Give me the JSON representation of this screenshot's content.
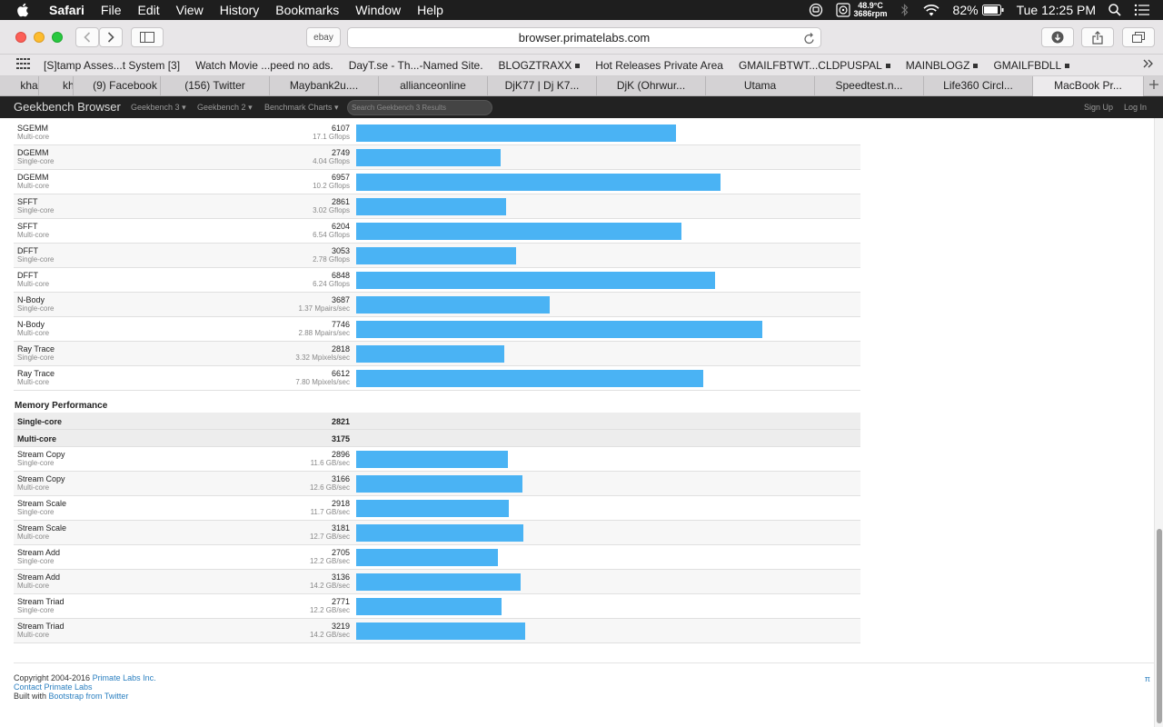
{
  "menubar": {
    "app": "Safari",
    "items": [
      "File",
      "Edit",
      "View",
      "History",
      "Bookmarks",
      "Window",
      "Help"
    ],
    "temp": "48.9°C",
    "fan": "3686rpm",
    "battery": "82%",
    "clock": "Tue 12:25 PM"
  },
  "toolbar": {
    "ebay_label": "ebay",
    "url": "browser.primatelabs.com"
  },
  "bookmarks": [
    {
      "label": "[S]tamp Asses...t System [3]",
      "folder": false
    },
    {
      "label": "Watch Movie ...peed no ads.",
      "folder": false
    },
    {
      "label": "DayT.se - Th...-Named Site.",
      "folder": false
    },
    {
      "label": "BLOGZTRAXX",
      "folder": true
    },
    {
      "label": "Hot Releases Private Area",
      "folder": false
    },
    {
      "label": "GMAILFBTWT...CLDPUSPAL",
      "folder": true
    },
    {
      "label": "MAINBLOGZ",
      "folder": true
    },
    {
      "label": "GMAILFBDLL",
      "folder": true
    }
  ],
  "tabs": [
    {
      "label": "kha"
    },
    {
      "label": "kh"
    },
    {
      "label": "(9) Facebook"
    },
    {
      "label": "(156) Twitter"
    },
    {
      "label": "Maybank2u...."
    },
    {
      "label": "allianceonline"
    },
    {
      "label": "DjK77 | Dj K7..."
    },
    {
      "label": "DjK (Ohrwur..."
    },
    {
      "label": "Utama"
    },
    {
      "label": "Speedtest.n..."
    },
    {
      "label": "Life360 Circl..."
    },
    {
      "label": "MacBook Pr..."
    }
  ],
  "gbnav": {
    "brand": "Geekbench Browser",
    "items": [
      "Geekbench 3",
      "Geekbench 2",
      "Benchmark Charts"
    ],
    "search_placeholder": "Search Geekbench 3 Results",
    "signup": "Sign Up",
    "login": "Log In"
  },
  "fp_rows": [
    {
      "name": "SGEMM",
      "mode": "Multi-core",
      "score": "6107",
      "rate": "17.1 Gflops"
    },
    {
      "name": "DGEMM",
      "mode": "Single-core",
      "score": "2749",
      "rate": "4.04 Gflops"
    },
    {
      "name": "DGEMM",
      "mode": "Multi-core",
      "score": "6957",
      "rate": "10.2 Gflops"
    },
    {
      "name": "SFFT",
      "mode": "Single-core",
      "score": "2861",
      "rate": "3.02 Gflops"
    },
    {
      "name": "SFFT",
      "mode": "Multi-core",
      "score": "6204",
      "rate": "6.54 Gflops"
    },
    {
      "name": "DFFT",
      "mode": "Single-core",
      "score": "3053",
      "rate": "2.78 Gflops"
    },
    {
      "name": "DFFT",
      "mode": "Multi-core",
      "score": "6848",
      "rate": "6.24 Gflops"
    },
    {
      "name": "N-Body",
      "mode": "Single-core",
      "score": "3687",
      "rate": "1.37 Mpairs/sec"
    },
    {
      "name": "N-Body",
      "mode": "Multi-core",
      "score": "7746",
      "rate": "2.88 Mpairs/sec"
    },
    {
      "name": "Ray Trace",
      "mode": "Single-core",
      "score": "2818",
      "rate": "3.32 Mpixels/sec"
    },
    {
      "name": "Ray Trace",
      "mode": "Multi-core",
      "score": "6612",
      "rate": "7.80 Mpixels/sec"
    }
  ],
  "memory": {
    "title": "Memory Performance",
    "summary": [
      {
        "label": "Single-core",
        "score": "2821"
      },
      {
        "label": "Multi-core",
        "score": "3175"
      }
    ],
    "rows": [
      {
        "name": "Stream Copy",
        "mode": "Single-core",
        "score": "2896",
        "rate": "11.6 GB/sec"
      },
      {
        "name": "Stream Copy",
        "mode": "Multi-core",
        "score": "3166",
        "rate": "12.6 GB/sec"
      },
      {
        "name": "Stream Scale",
        "mode": "Single-core",
        "score": "2918",
        "rate": "11.7 GB/sec"
      },
      {
        "name": "Stream Scale",
        "mode": "Multi-core",
        "score": "3181",
        "rate": "12.7 GB/sec"
      },
      {
        "name": "Stream Add",
        "mode": "Single-core",
        "score": "2705",
        "rate": "12.2 GB/sec"
      },
      {
        "name": "Stream Add",
        "mode": "Multi-core",
        "score": "3136",
        "rate": "14.2 GB/sec"
      },
      {
        "name": "Stream Triad",
        "mode": "Single-core",
        "score": "2771",
        "rate": "12.2 GB/sec"
      },
      {
        "name": "Stream Triad",
        "mode": "Multi-core",
        "score": "3219",
        "rate": "14.2 GB/sec"
      }
    ]
  },
  "footer": {
    "copyright_prefix": "Copyright 2004-2016 ",
    "company": "Primate Labs Inc.",
    "contact": "Contact Primate Labs",
    "built_prefix": "Built with ",
    "bootstrap": "Bootstrap from Twitter",
    "pi": "π"
  },
  "colors": {
    "bar": "#4ab3f4",
    "link": "#2a7fc0"
  }
}
